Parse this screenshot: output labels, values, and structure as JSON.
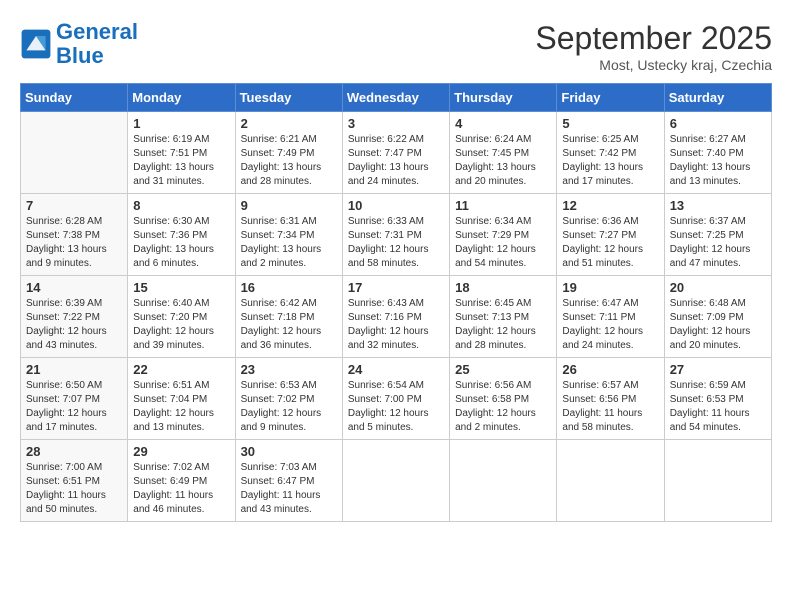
{
  "logo": {
    "line1": "General",
    "line2": "Blue"
  },
  "title": "September 2025",
  "location": "Most, Ustecky kraj, Czechia",
  "days_of_week": [
    "Sunday",
    "Monday",
    "Tuesday",
    "Wednesday",
    "Thursday",
    "Friday",
    "Saturday"
  ],
  "weeks": [
    [
      {
        "day": "",
        "info": ""
      },
      {
        "day": "1",
        "info": "Sunrise: 6:19 AM\nSunset: 7:51 PM\nDaylight: 13 hours\nand 31 minutes."
      },
      {
        "day": "2",
        "info": "Sunrise: 6:21 AM\nSunset: 7:49 PM\nDaylight: 13 hours\nand 28 minutes."
      },
      {
        "day": "3",
        "info": "Sunrise: 6:22 AM\nSunset: 7:47 PM\nDaylight: 13 hours\nand 24 minutes."
      },
      {
        "day": "4",
        "info": "Sunrise: 6:24 AM\nSunset: 7:45 PM\nDaylight: 13 hours\nand 20 minutes."
      },
      {
        "day": "5",
        "info": "Sunrise: 6:25 AM\nSunset: 7:42 PM\nDaylight: 13 hours\nand 17 minutes."
      },
      {
        "day": "6",
        "info": "Sunrise: 6:27 AM\nSunset: 7:40 PM\nDaylight: 13 hours\nand 13 minutes."
      }
    ],
    [
      {
        "day": "7",
        "info": "Sunrise: 6:28 AM\nSunset: 7:38 PM\nDaylight: 13 hours\nand 9 minutes."
      },
      {
        "day": "8",
        "info": "Sunrise: 6:30 AM\nSunset: 7:36 PM\nDaylight: 13 hours\nand 6 minutes."
      },
      {
        "day": "9",
        "info": "Sunrise: 6:31 AM\nSunset: 7:34 PM\nDaylight: 13 hours\nand 2 minutes."
      },
      {
        "day": "10",
        "info": "Sunrise: 6:33 AM\nSunset: 7:31 PM\nDaylight: 12 hours\nand 58 minutes."
      },
      {
        "day": "11",
        "info": "Sunrise: 6:34 AM\nSunset: 7:29 PM\nDaylight: 12 hours\nand 54 minutes."
      },
      {
        "day": "12",
        "info": "Sunrise: 6:36 AM\nSunset: 7:27 PM\nDaylight: 12 hours\nand 51 minutes."
      },
      {
        "day": "13",
        "info": "Sunrise: 6:37 AM\nSunset: 7:25 PM\nDaylight: 12 hours\nand 47 minutes."
      }
    ],
    [
      {
        "day": "14",
        "info": "Sunrise: 6:39 AM\nSunset: 7:22 PM\nDaylight: 12 hours\nand 43 minutes."
      },
      {
        "day": "15",
        "info": "Sunrise: 6:40 AM\nSunset: 7:20 PM\nDaylight: 12 hours\nand 39 minutes."
      },
      {
        "day": "16",
        "info": "Sunrise: 6:42 AM\nSunset: 7:18 PM\nDaylight: 12 hours\nand 36 minutes."
      },
      {
        "day": "17",
        "info": "Sunrise: 6:43 AM\nSunset: 7:16 PM\nDaylight: 12 hours\nand 32 minutes."
      },
      {
        "day": "18",
        "info": "Sunrise: 6:45 AM\nSunset: 7:13 PM\nDaylight: 12 hours\nand 28 minutes."
      },
      {
        "day": "19",
        "info": "Sunrise: 6:47 AM\nSunset: 7:11 PM\nDaylight: 12 hours\nand 24 minutes."
      },
      {
        "day": "20",
        "info": "Sunrise: 6:48 AM\nSunset: 7:09 PM\nDaylight: 12 hours\nand 20 minutes."
      }
    ],
    [
      {
        "day": "21",
        "info": "Sunrise: 6:50 AM\nSunset: 7:07 PM\nDaylight: 12 hours\nand 17 minutes."
      },
      {
        "day": "22",
        "info": "Sunrise: 6:51 AM\nSunset: 7:04 PM\nDaylight: 12 hours\nand 13 minutes."
      },
      {
        "day": "23",
        "info": "Sunrise: 6:53 AM\nSunset: 7:02 PM\nDaylight: 12 hours\nand 9 minutes."
      },
      {
        "day": "24",
        "info": "Sunrise: 6:54 AM\nSunset: 7:00 PM\nDaylight: 12 hours\nand 5 minutes."
      },
      {
        "day": "25",
        "info": "Sunrise: 6:56 AM\nSunset: 6:58 PM\nDaylight: 12 hours\nand 2 minutes."
      },
      {
        "day": "26",
        "info": "Sunrise: 6:57 AM\nSunset: 6:56 PM\nDaylight: 11 hours\nand 58 minutes."
      },
      {
        "day": "27",
        "info": "Sunrise: 6:59 AM\nSunset: 6:53 PM\nDaylight: 11 hours\nand 54 minutes."
      }
    ],
    [
      {
        "day": "28",
        "info": "Sunrise: 7:00 AM\nSunset: 6:51 PM\nDaylight: 11 hours\nand 50 minutes."
      },
      {
        "day": "29",
        "info": "Sunrise: 7:02 AM\nSunset: 6:49 PM\nDaylight: 11 hours\nand 46 minutes."
      },
      {
        "day": "30",
        "info": "Sunrise: 7:03 AM\nSunset: 6:47 PM\nDaylight: 11 hours\nand 43 minutes."
      },
      {
        "day": "",
        "info": ""
      },
      {
        "day": "",
        "info": ""
      },
      {
        "day": "",
        "info": ""
      },
      {
        "day": "",
        "info": ""
      }
    ]
  ]
}
